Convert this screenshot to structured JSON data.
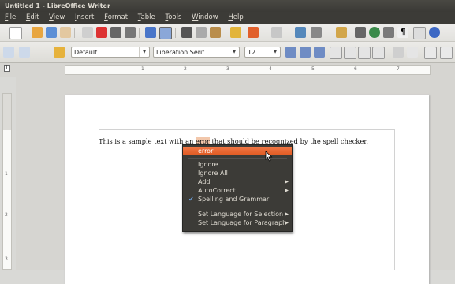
{
  "window": {
    "title": "Untitled 1 - LibreOffice Writer"
  },
  "menubar": {
    "items": [
      "File",
      "Edit",
      "View",
      "Insert",
      "Format",
      "Table",
      "Tools",
      "Window",
      "Help"
    ]
  },
  "formatting": {
    "style": "Default",
    "font": "Liberation Serif",
    "size": "12"
  },
  "ruler": {
    "marks": [
      "1",
      "2",
      "3",
      "4",
      "5",
      "6",
      "7"
    ]
  },
  "vruler": {
    "marks": [
      "1",
      "2",
      "3"
    ]
  },
  "document": {
    "text_before": "This is a sample text with an ",
    "error_word": "eror",
    "text_after": " that should be recognized by the spell checker."
  },
  "context_menu": {
    "suggestion": "error",
    "ignore": "Ignore",
    "ignore_all": "Ignore All",
    "add": "Add",
    "autocorrect": "AutoCorrect",
    "spelling_grammar": "Spelling and Grammar",
    "set_lang_selection": "Set Language for Selection",
    "set_lang_paragraph": "Set Language for Paragraph"
  },
  "colors": {
    "menu_bg": "#3c3b37",
    "highlight": "#e85d22",
    "error_bg": "#f2c7ab"
  }
}
